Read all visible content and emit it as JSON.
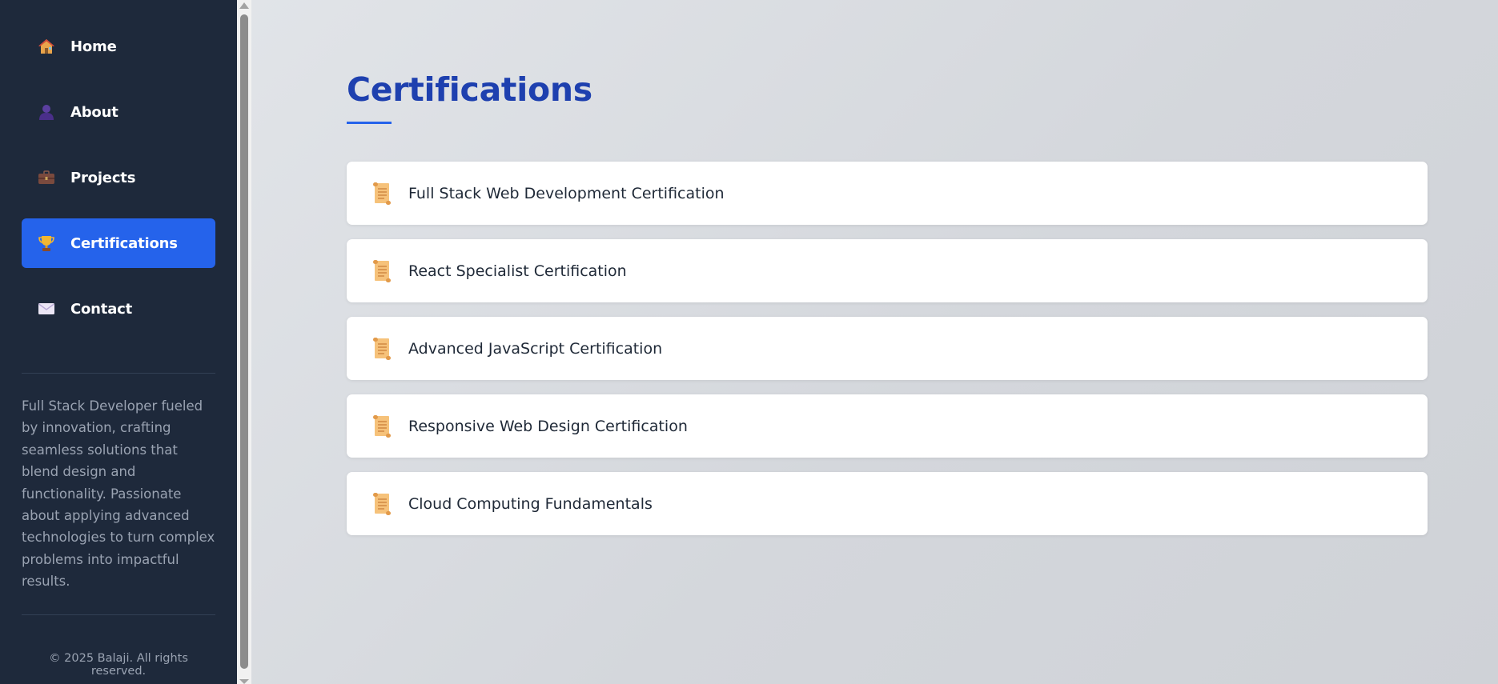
{
  "sidebar": {
    "nav": [
      {
        "label": "Home",
        "icon": "house-icon",
        "active": false
      },
      {
        "label": "About",
        "icon": "person-icon",
        "active": false
      },
      {
        "label": "Projects",
        "icon": "briefcase-icon",
        "active": false
      },
      {
        "label": "Certifications",
        "icon": "trophy-icon",
        "active": true
      },
      {
        "label": "Contact",
        "icon": "envelope-icon",
        "active": false
      }
    ],
    "bio": "Full Stack Developer fueled by innovation, crafting seamless solutions that blend design and functionality. Passionate about applying advanced technologies to turn complex problems into impactful results.",
    "footer": "© 2025 Balaji. All rights reserved."
  },
  "main": {
    "title": "Certifications",
    "certifications": [
      {
        "name": "Full Stack Web Development Certification",
        "icon": "scroll-icon"
      },
      {
        "name": "React Specialist Certification",
        "icon": "scroll-icon"
      },
      {
        "name": "Advanced JavaScript Certification",
        "icon": "scroll-icon"
      },
      {
        "name": "Responsive Web Design Certification",
        "icon": "scroll-icon"
      },
      {
        "name": "Cloud Computing Fundamentals",
        "icon": "scroll-icon"
      }
    ]
  },
  "colors": {
    "sidebar_bg": "#1e293b",
    "accent": "#2563eb",
    "title": "#1e40af"
  }
}
